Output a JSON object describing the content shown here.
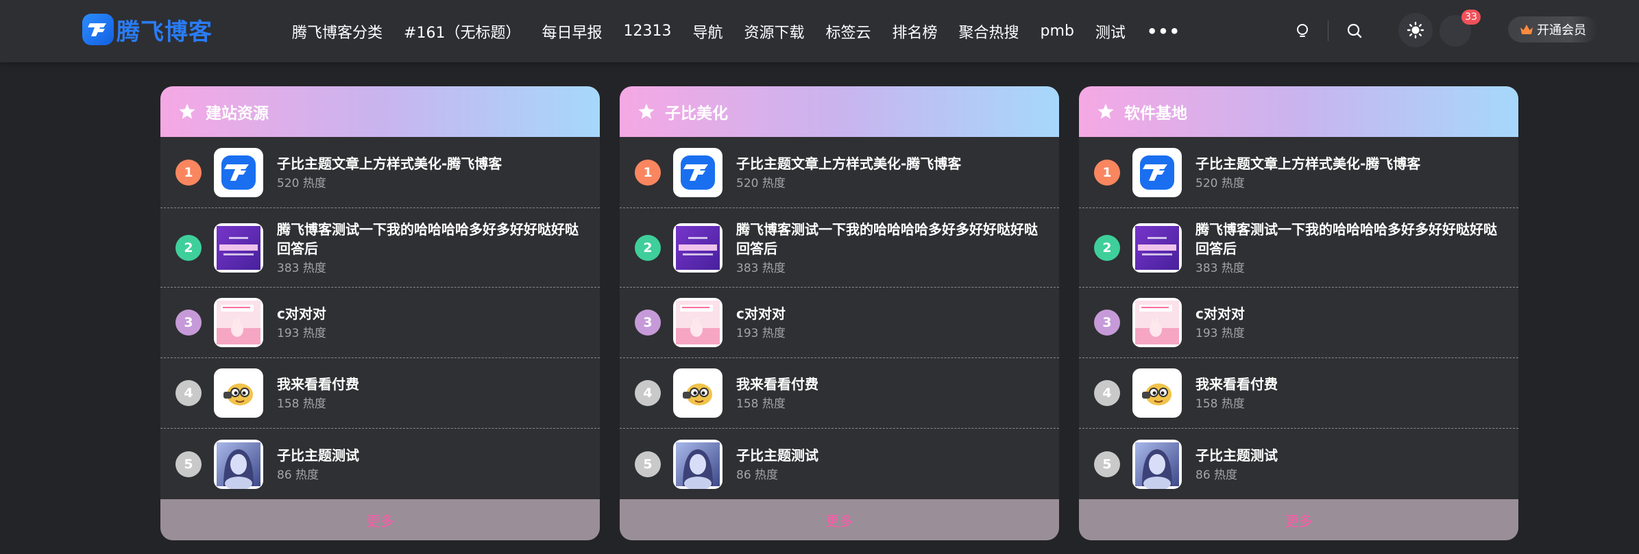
{
  "header": {
    "logo_text": "腾飞博客",
    "nav_items": [
      "腾飞博客分类",
      "#161（无标题）",
      "每日早报",
      "12313",
      "导航",
      "资源下载",
      "标签云",
      "排名榜",
      "聚合热搜",
      "pmb",
      "测试"
    ],
    "more_label": "•••",
    "message_count": "33",
    "vip_label": "开通会员"
  },
  "colors": {
    "accent_blue": "#2a7cf5",
    "more_link": "#ff5aa8",
    "rank_1": "#f9865f",
    "rank_2": "#3fcf9b",
    "rank_3": "#c69ad8",
    "rank_4": "#c9c9c9",
    "rank_5": "#c9c9c9"
  },
  "cards": [
    {
      "title": "建站资源",
      "more_label": "更多",
      "posts": [
        {
          "rank": "1",
          "title": "子比主题文章上方样式美化-腾飞博客",
          "heat": "520 热度",
          "thumb": "logo"
        },
        {
          "rank": "2",
          "title": "腾飞博客测试一下我的哈哈哈哈多好多好好哒好哒回答后",
          "heat": "383 热度",
          "thumb": "purple-banner"
        },
        {
          "rank": "3",
          "title": "c对对对",
          "heat": "193 热度",
          "thumb": "pink-hand"
        },
        {
          "rank": "4",
          "title": "我来看看付费",
          "heat": "158 热度",
          "thumb": "emoji"
        },
        {
          "rank": "5",
          "title": "子比主题测试",
          "heat": "86 热度",
          "thumb": "portrait"
        }
      ]
    },
    {
      "title": "子比美化",
      "more_label": "更多",
      "posts": [
        {
          "rank": "1",
          "title": "子比主题文章上方样式美化-腾飞博客",
          "heat": "520 热度",
          "thumb": "logo"
        },
        {
          "rank": "2",
          "title": "腾飞博客测试一下我的哈哈哈哈多好多好好哒好哒回答后",
          "heat": "383 热度",
          "thumb": "purple-banner"
        },
        {
          "rank": "3",
          "title": "c对对对",
          "heat": "193 热度",
          "thumb": "pink-hand"
        },
        {
          "rank": "4",
          "title": "我来看看付费",
          "heat": "158 热度",
          "thumb": "emoji"
        },
        {
          "rank": "5",
          "title": "子比主题测试",
          "heat": "86 热度",
          "thumb": "portrait"
        }
      ]
    },
    {
      "title": "软件基地",
      "more_label": "更多",
      "posts": [
        {
          "rank": "1",
          "title": "子比主题文章上方样式美化-腾飞博客",
          "heat": "520 热度",
          "thumb": "logo"
        },
        {
          "rank": "2",
          "title": "腾飞博客测试一下我的哈哈哈哈多好多好好哒好哒回答后",
          "heat": "383 热度",
          "thumb": "purple-banner"
        },
        {
          "rank": "3",
          "title": "c对对对",
          "heat": "193 热度",
          "thumb": "pink-hand"
        },
        {
          "rank": "4",
          "title": "我来看看付费",
          "heat": "158 热度",
          "thumb": "emoji"
        },
        {
          "rank": "5",
          "title": "子比主题测试",
          "heat": "86 热度",
          "thumb": "portrait"
        }
      ]
    }
  ]
}
